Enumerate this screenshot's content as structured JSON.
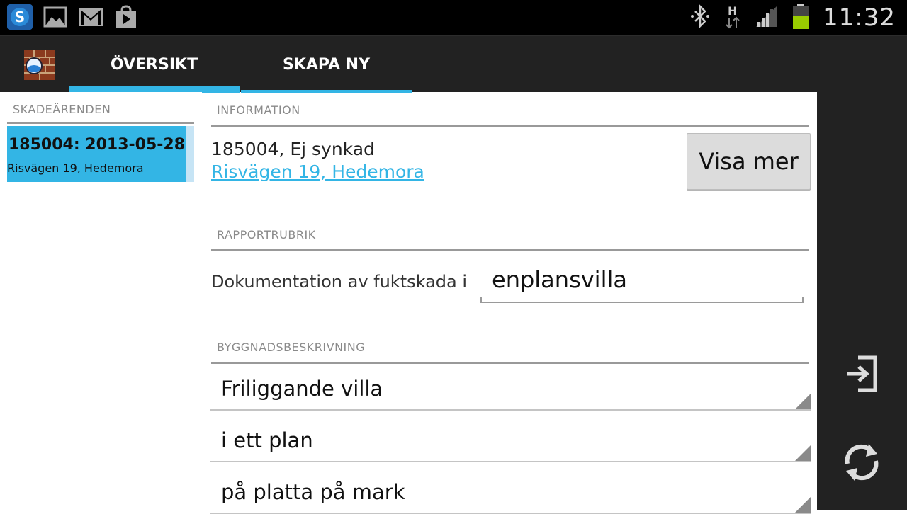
{
  "status_bar": {
    "icons_left": [
      "skype-icon",
      "gallery-icon",
      "gmail-icon",
      "play-store-icon"
    ],
    "icons_right": [
      "bluetooth-icon",
      "data-h-icon",
      "signal-icon",
      "battery-icon"
    ],
    "clock": "11:32"
  },
  "action_bar": {
    "tabs": [
      {
        "label": "ÖVERSIKT",
        "selected": true
      },
      {
        "label": "SKAPA NY",
        "selected": false
      }
    ],
    "accent_color": "#33b5e5"
  },
  "sidebar": {
    "header": "SKADEÄRENDEN",
    "items": [
      {
        "title": "185004: 2013-05-28",
        "address": "Risvägen 19, Hedemora",
        "selected": true
      }
    ]
  },
  "main": {
    "information": {
      "header": "INFORMATION",
      "case_text": "185004, Ej synkad",
      "address_link": "Risvägen 19, Hedemora",
      "more_button": "Visa mer"
    },
    "report_title": {
      "header": "RAPPORTRUBRIK",
      "prefix": "Dokumentation av fuktskada i",
      "value": "enplansvilla"
    },
    "building": {
      "header": "BYGGNADSBESKRIVNING",
      "spinners": [
        "Friliggande villa",
        "i ett plan",
        "på platta på mark"
      ]
    }
  },
  "right_panel": {
    "icons": [
      "login-icon",
      "sync-icon"
    ]
  }
}
